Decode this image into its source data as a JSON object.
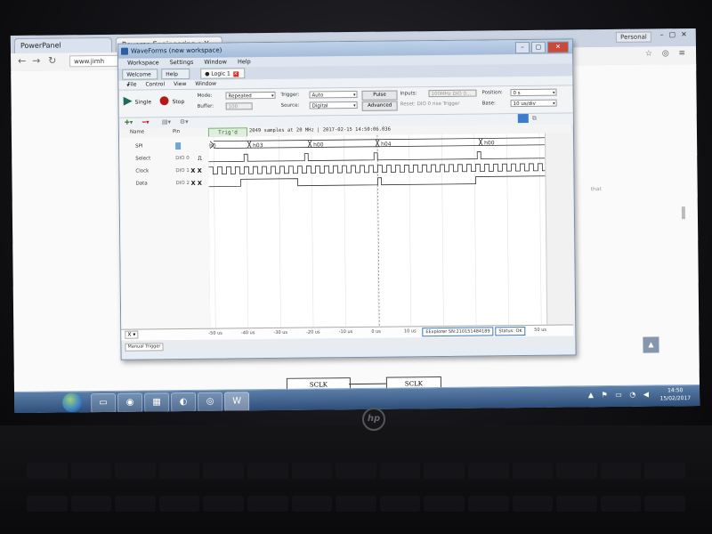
{
  "browser": {
    "tabs": [
      "PowerPanel",
      "Reverse Engineering a Y"
    ],
    "profile": "Personal",
    "url": "www.jimh",
    "page_side_text": "that",
    "diagram_labels": [
      "SCLK",
      "SCLK"
    ]
  },
  "waveforms": {
    "title": "WaveForms (new workspace)",
    "menu": [
      "Workspace",
      "Settings",
      "Window",
      "Help"
    ],
    "tabs": [
      "Welcome",
      "Help",
      "Logic 1"
    ],
    "submenu": [
      "File",
      "Control",
      "View",
      "Window"
    ],
    "toolbar": {
      "single": "Single",
      "stop": "Stop",
      "mode_label": "Mode:",
      "mode_value": "Repeated",
      "buffer_label": "Buffer:",
      "buffer_value": "100",
      "trigger_label": "Trigger:",
      "trigger_value": "Auto",
      "source_label": "Source:",
      "source_value": "Digital",
      "pulse": "Pulse",
      "advanced": "Advanced",
      "inputs_label": "Inputs:",
      "inputs_value": "100MHz DIO 0...",
      "reset_text": "Reset: DIO 0 rise Trigger",
      "position_label": "Position:",
      "position_value": "0 s",
      "base_label": "Base:",
      "base_value": "10 us/div"
    },
    "header": {
      "name": "Name",
      "pin": "Pin",
      "trigd": "Trig'd",
      "samples": "2049 samples at 20 MHz | 2017-02-15 14:50:06.036"
    },
    "signals": [
      {
        "name": "SPI",
        "pin": ""
      },
      {
        "name": "Select",
        "pin": "DIO 0"
      },
      {
        "name": "Clock",
        "pin": "DIO 1"
      },
      {
        "name": "Data",
        "pin": "DIO 2"
      }
    ],
    "bus_labels": [
      "h0",
      "h03",
      "h00",
      "h04",
      "h00"
    ],
    "axis_ticks": [
      "-50 us",
      "-40 us",
      "-30 us",
      "-20 us",
      "-10 us",
      "0 us",
      "10 us",
      "20 us",
      "30 us",
      "40 us",
      "50 us"
    ],
    "axis_x_label": "X",
    "status": {
      "manual_trigger": "Manual Trigger",
      "device": "EExplorer SN:210151484189",
      "status": "Status: OK"
    }
  },
  "taskbar": {
    "time": "14:50",
    "date": "15/02/2017"
  },
  "colors": {
    "trig_green": "#7ab66f",
    "wave": "#333333",
    "taskbar": "#2c4c77"
  }
}
